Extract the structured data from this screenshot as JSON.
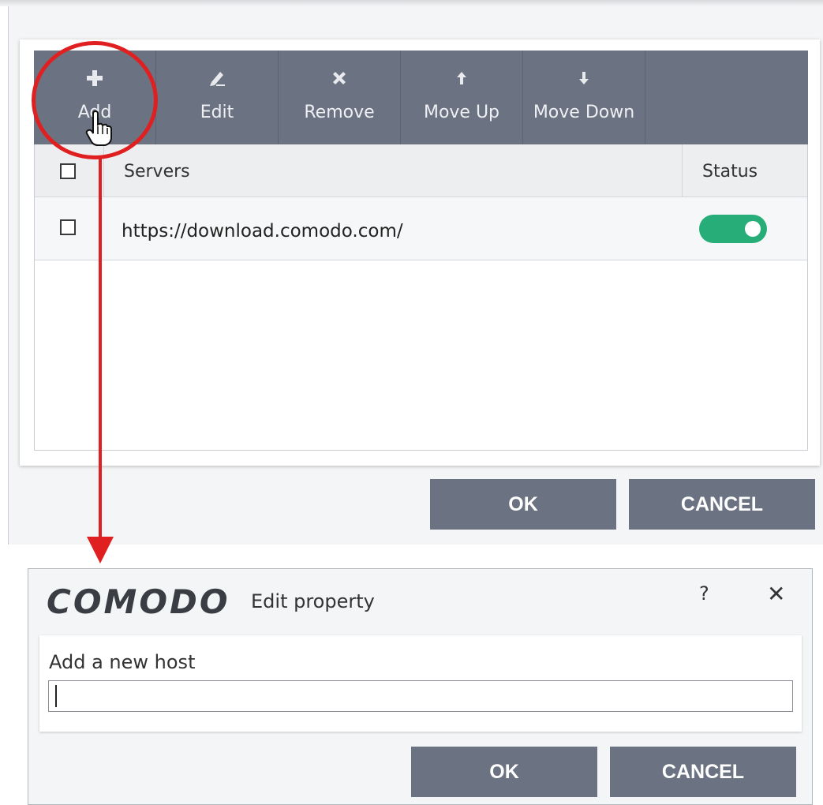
{
  "toolbar": {
    "buttons": [
      {
        "label": "Add",
        "icon": "plus-icon"
      },
      {
        "label": "Edit",
        "icon": "pencil-icon"
      },
      {
        "label": "Remove",
        "icon": "x-icon"
      },
      {
        "label": "Move Up",
        "icon": "arrow-up-icon"
      },
      {
        "label": "Move Down",
        "icon": "arrow-down-icon"
      }
    ]
  },
  "grid": {
    "headers": {
      "servers": "Servers",
      "status": "Status"
    },
    "rows": [
      {
        "server": "https://download.comodo.com/",
        "enabled": true
      }
    ]
  },
  "main_buttons": {
    "ok": "OK",
    "cancel": "CANCEL"
  },
  "dialog": {
    "brand": "COMODO",
    "title": "Edit property",
    "help": "?",
    "close": "✕",
    "field_label": "Add a new host",
    "field_value": "",
    "ok": "OK",
    "cancel": "CANCEL"
  },
  "colors": {
    "toolbar": "#6b7281",
    "toggle_on": "#27ae78",
    "annotation": "#e02020"
  }
}
